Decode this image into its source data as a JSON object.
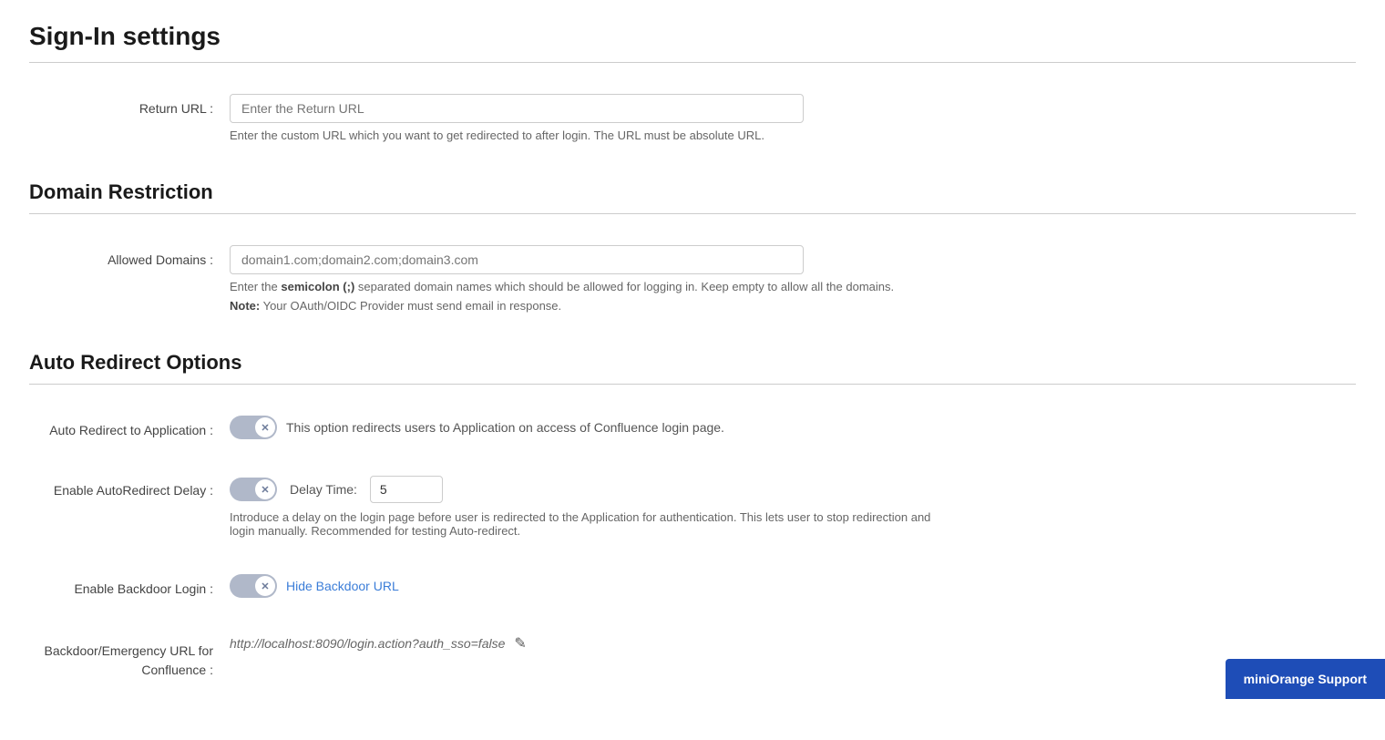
{
  "page": {
    "title": "Sign-In settings"
  },
  "sections": {
    "return_url": {
      "label": "Return URL :",
      "input_placeholder": "Enter the Return URL",
      "helper": "Enter the custom URL which you want to get redirected to after login. The URL must be absolute URL."
    },
    "domain_restriction": {
      "title": "Domain Restriction",
      "allowed_domains": {
        "label": "Allowed Domains :",
        "input_placeholder": "domain1.com;domain2.com;domain3.com",
        "helper_part1": "Enter the ",
        "helper_bold": "semicolon (;)",
        "helper_part2": " separated domain names which should be allowed for logging in. Keep empty to allow all the domains.",
        "note_bold": "Note:",
        "note_text": " Your OAuth/OIDC Provider must send email in response."
      }
    },
    "auto_redirect": {
      "title": "Auto Redirect Options",
      "auto_redirect_app": {
        "label": "Auto Redirect to Application :",
        "description": "This option redirects users to Application on access of Confluence login page."
      },
      "auto_redirect_delay": {
        "label": "Enable AutoRedirect Delay :",
        "delay_label": "Delay Time:",
        "delay_value": "5",
        "helper": "Introduce a delay on the login page before user is redirected to the Application for authentication. This lets user to stop redirection and login manually. Recommended for testing Auto-redirect."
      },
      "backdoor_login": {
        "label": "Enable Backdoor Login :",
        "link_text": "Hide Backdoor URL"
      },
      "backdoor_url": {
        "label": "Backdoor/Emergency URL for\nConfluence :",
        "url_text": "http://localhost:8090/login.action?auth_sso=false",
        "edit_icon": "✎"
      }
    }
  },
  "support_button": {
    "label": "miniOrange Support"
  }
}
